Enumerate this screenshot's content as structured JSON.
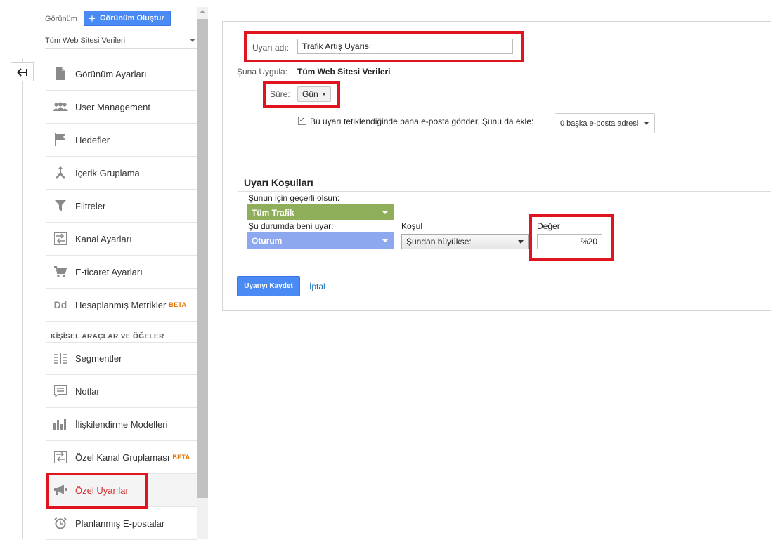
{
  "sidebar": {
    "view_label": "Görünüm",
    "create_view_button": "Görünüm Oluştur",
    "view_selector": "Tüm Web Sitesi Verileri",
    "back_icon": "arrow-left-icon",
    "section_title": "KİŞİSEL ARAÇLAR VE ÖĞELER",
    "items": [
      {
        "label": "Görünüm Ayarları",
        "icon": "document-icon",
        "badge": ""
      },
      {
        "label": "User Management",
        "icon": "users-icon",
        "badge": ""
      },
      {
        "label": "Hedefler",
        "icon": "flag-icon",
        "badge": ""
      },
      {
        "label": "İçerik Gruplama",
        "icon": "content-grouping-icon",
        "badge": ""
      },
      {
        "label": "Filtreler",
        "icon": "filter-icon",
        "badge": ""
      },
      {
        "label": "Kanal Ayarları",
        "icon": "channel-settings-icon",
        "badge": ""
      },
      {
        "label": "E-ticaret Ayarları",
        "icon": "cart-icon",
        "badge": ""
      },
      {
        "label": "Hesaplanmış Metrikler",
        "icon": "dd-icon",
        "badge": "BETA"
      },
      {
        "label": "Segmentler",
        "icon": "segments-icon",
        "badge": ""
      },
      {
        "label": "Notlar",
        "icon": "notes-icon",
        "badge": ""
      },
      {
        "label": "İlişkilendirme Modelleri",
        "icon": "attribution-icon",
        "badge": ""
      },
      {
        "label": "Özel Kanal Gruplaması",
        "icon": "channel-grouping-icon",
        "badge": "BETA"
      },
      {
        "label": "Özel Uyarılar",
        "icon": "megaphone-icon",
        "badge": ""
      },
      {
        "label": "Planlanmış E-postalar",
        "icon": "alarm-clock-icon",
        "badge": ""
      }
    ]
  },
  "form": {
    "alert_name_label": "Uyarı adı:",
    "alert_name_value": "Trafik Artış Uyarısı",
    "apply_to_label": "Şuna Uygula:",
    "apply_to_value": "Tüm Web Sitesi Verileri",
    "period_label": "Süre:",
    "period_value": "Gün",
    "email_checkbox_checked": true,
    "email_text": "Bu uyarı tetiklendiğinde bana e-posta gönder. Şunu da ekle:",
    "email_dropdown": "0 başka e-posta adresi",
    "conditions_title": "Uyarı Koşulları",
    "applies_to_label": "Şunun için geçerli olsun:",
    "applies_to_value": "Tüm Trafik",
    "applies_to_color": "#8fae5a",
    "alert_me_label": "Şu durumda beni uyar:",
    "alert_me_value": "Oturum",
    "alert_me_color": "#8ea8f0",
    "condition_label": "Koşul",
    "condition_value": "Şundan büyükse:",
    "value_label": "Değer",
    "value_value": "%20",
    "save_button": "Uyarıyı Kaydet",
    "cancel_link": "İptal"
  },
  "highlight_color": "#e0141e"
}
